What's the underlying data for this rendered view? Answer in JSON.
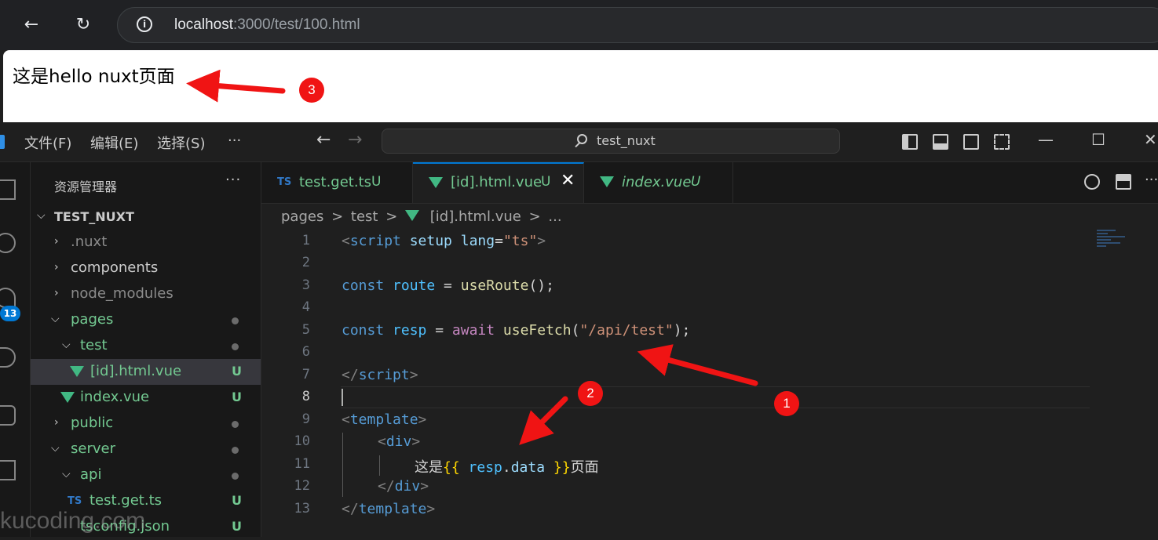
{
  "browser": {
    "url_host": "localhost",
    "url_path": ":3000/test/100.html",
    "page_text": "这是hello nuxt页面"
  },
  "vscode": {
    "menu": [
      "文件(F)",
      "编辑(E)",
      "选择(S)",
      "···"
    ],
    "command_center": "test_nuxt",
    "activity_badge": "13",
    "explorer": {
      "title": "资源管理器",
      "more": "···",
      "root": "TEST_NUXT",
      "items": [
        {
          "label": ".nuxt",
          "status": ""
        },
        {
          "label": "components",
          "status": ""
        },
        {
          "label": "node_modules",
          "status": ""
        },
        {
          "label": "pages",
          "status": "dot"
        },
        {
          "label": "test",
          "status": "dot"
        },
        {
          "label": "[id].html.vue",
          "status": "U"
        },
        {
          "label": "index.vue",
          "status": "U"
        },
        {
          "label": "public",
          "status": "dot"
        },
        {
          "label": "server",
          "status": "dot"
        },
        {
          "label": "api",
          "status": "dot"
        },
        {
          "label": "test.get.ts",
          "status": "U"
        },
        {
          "label": "tsconfig.json",
          "status": "U"
        }
      ]
    },
    "tabs": [
      {
        "icon": "TS",
        "label": "test.get.ts",
        "status": "U"
      },
      {
        "label": "[id].html.vue",
        "status": "U",
        "close": "✕"
      },
      {
        "label": "index.vue",
        "status": "U"
      }
    ],
    "breadcrumb": [
      "pages",
      ">",
      "test",
      ">",
      "[id].html.vue",
      ">",
      "..."
    ],
    "code": {
      "lines": [
        "1",
        "2",
        "3",
        "4",
        "5",
        "6",
        "7",
        "8",
        "9",
        "10",
        "11",
        "12",
        "13"
      ],
      "l1": {
        "a": "<",
        "b": "script",
        "c": " setup",
        "d": " lang",
        "e": "=",
        "f": "\"ts\"",
        "g": ">"
      },
      "l3": {
        "a": "const",
        "b": " route",
        "c": " = ",
        "d": "useRoute",
        "e": "();"
      },
      "l5": {
        "a": "const",
        "b": " resp",
        "c": " = ",
        "d": "await",
        "e": " useFetch",
        "f": "(",
        "g": "\"/api/test\"",
        "h": ");"
      },
      "l7": {
        "a": "</",
        "b": "script",
        "c": ">"
      },
      "l9": {
        "a": "<",
        "b": "template",
        "c": ">"
      },
      "l10": {
        "a": "<",
        "b": "div",
        "c": ">"
      },
      "l11": {
        "a": "这是",
        "b": "{{",
        "c": " resp",
        "d": ".",
        "e": "data",
        "f": " }}",
        "g": "页面"
      },
      "l12": {
        "a": "</",
        "b": "div",
        "c": ">"
      },
      "l13": {
        "a": "</",
        "b": "template",
        "c": ">"
      }
    }
  },
  "annotations": [
    "1",
    "2",
    "3"
  ],
  "watermark": "kucoding.com"
}
